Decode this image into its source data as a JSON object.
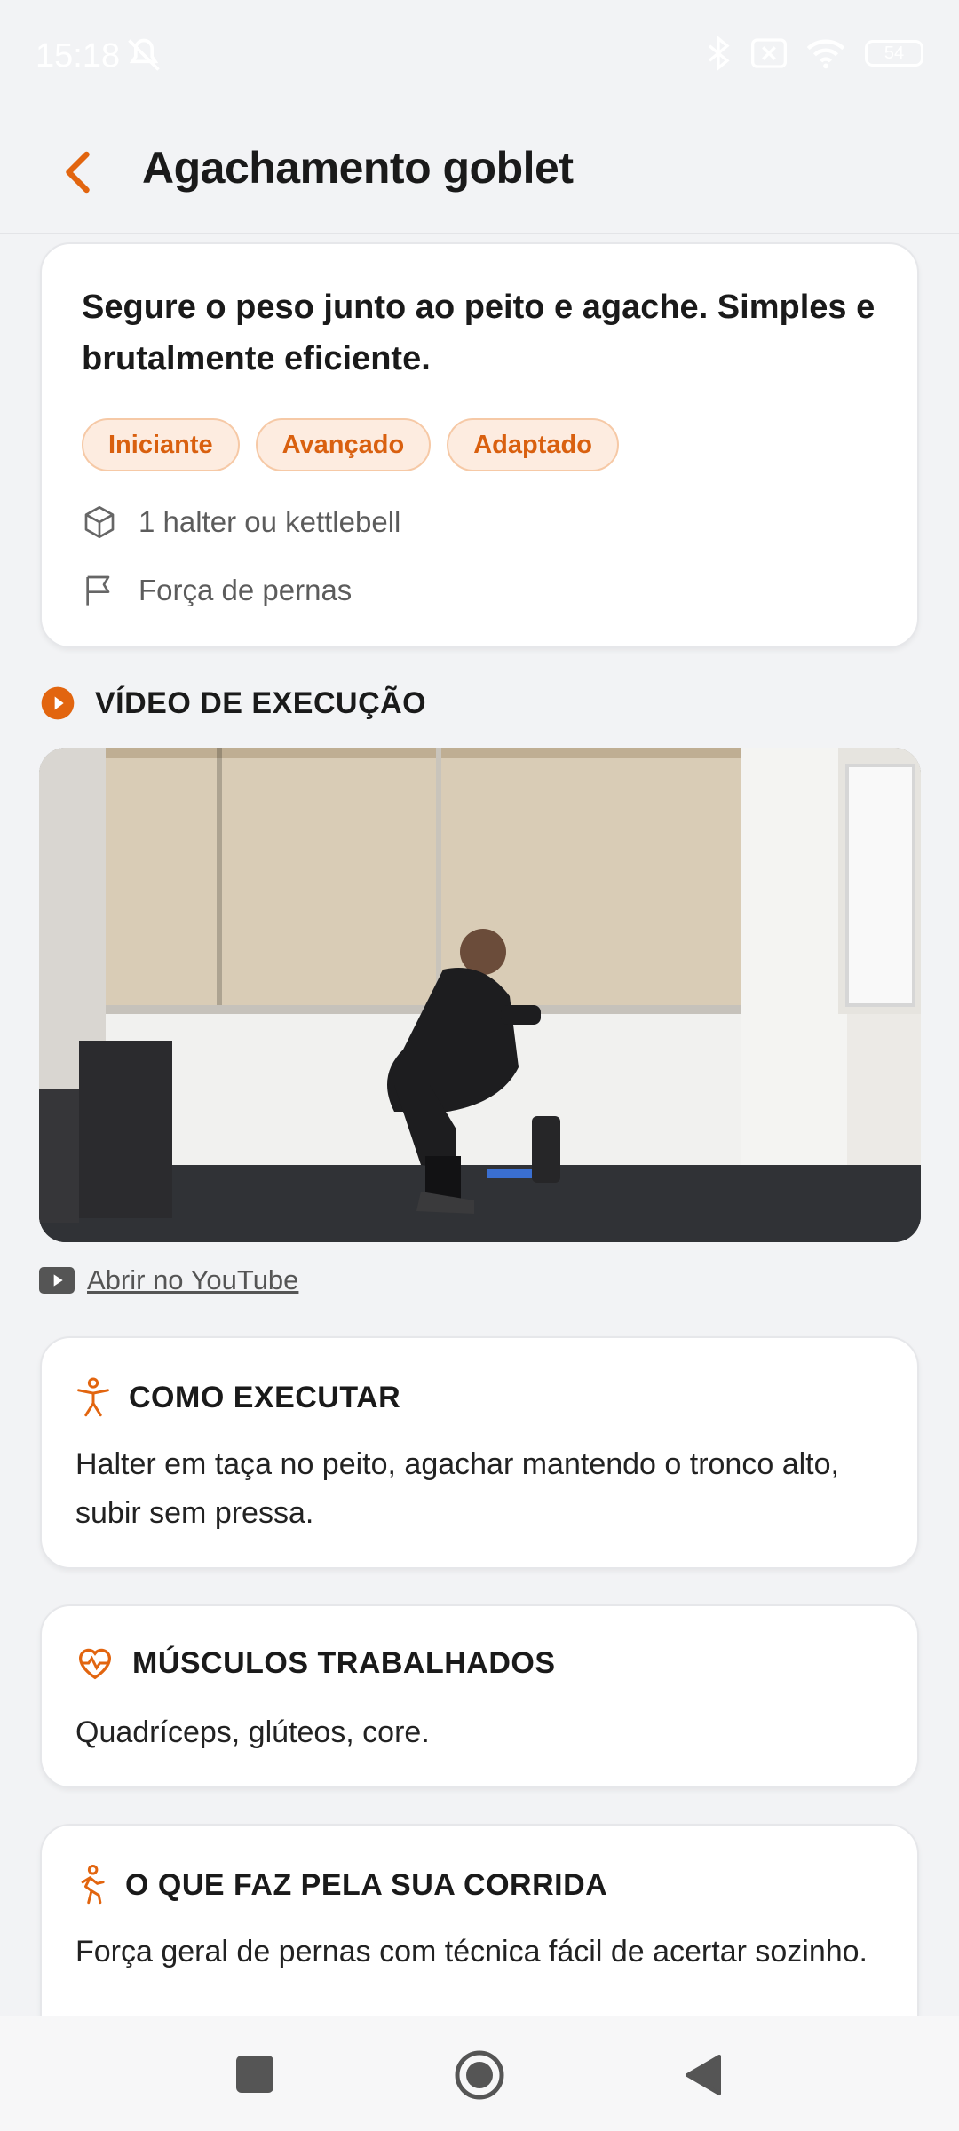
{
  "status_bar": {
    "time": "15:18",
    "battery": "54"
  },
  "header": {
    "title": "Agachamento goblet"
  },
  "summary": {
    "description": "Segure o peso junto ao peito e agache. Simples e brutalmente eficiente.",
    "tags": [
      "Iniciante",
      "Avançado",
      "Adaptado"
    ],
    "equipment": "1 halter ou kettlebell",
    "goal": "Força de pernas"
  },
  "video_section": {
    "title": "VÍDEO DE EXECUÇÃO",
    "youtube_link": "Abrir no YouTube"
  },
  "how_to": {
    "title": "COMO EXECUTAR",
    "text": "Halter em taça no peito, agachar mantendo o tronco alto, subir sem pressa."
  },
  "muscles": {
    "title": "MÚSCULOS TRABALHADOS",
    "text": "Quadríceps, glúteos, core."
  },
  "running_benefit": {
    "title": "O QUE FAZ PELA SUA CORRIDA",
    "text": "Força geral de pernas com técnica fácil de acertar sozinho."
  },
  "colors": {
    "accent": "#e2650f",
    "tag_bg": "#fdece0",
    "background": "#f2f3f5"
  }
}
